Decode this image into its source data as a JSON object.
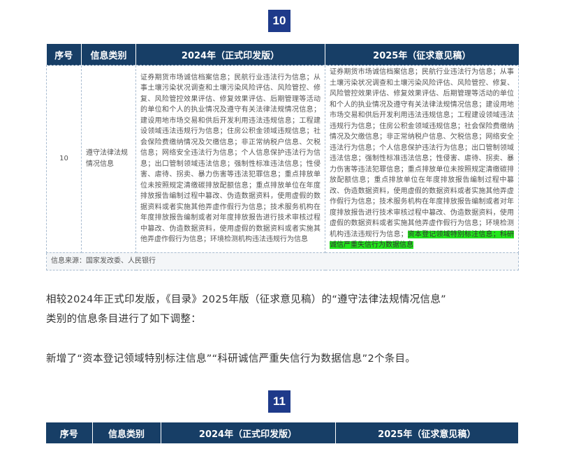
{
  "section1": {
    "badge": "10",
    "headers": [
      "序号",
      "信息类别",
      "2024年（正式印发版）",
      "2025年（征求意见稿）"
    ],
    "row": {
      "num": "10",
      "category": "遵守法律法规情况信息",
      "col2024": "证券期货市场诚信档案信息；民航行业违法行为信息；从事土壤污染状况调查和土壤污染风险评估、风险管控、修复、风险管控效果评估、修复效果评估、后期管理等活动的单位和个人的执业情况及遵守有关法律法规情况信息；建设用地市场交易和供后开发利用违法违规信息；工程建设领域违法违规行为信息；住房公积金领域违规信息；社会保险费缴纳情况及欠缴信息；非正常纳税户信息、欠税信息；网络安全违法行为信息；个人信息保护违法行为信息；出口管制领域违法信息；强制性标准违法信息；性侵害、虐待、拐卖、暴力伤害等违法犯罪信息；重点排放单位未按照规定清缴碳排放配额信息；重点排放单位在年度排放报告编制过程中篡改、伪造数据资料，使用虚假的数据资料或者实施其他弄虚作假行为信息；技术服务机构在年度排放报告编制或者对年度排放报告进行技术审核过程中篡改、伪造数据资料，使用虚假的数据资料或者实施其他弄虚作假行为信息；环境检测机构违法违规行为信息",
      "col2025_main": "证券期货市场诚信档案信息；民航行业违法行为信息；从事土壤污染状况调查和土壤污染风险评估、风险管控、修复、风险管控效果评估、修复效果评估、后期管理等活动的单位和个人的执业情况及遵守有关法律法规情况信息；建设用地市场交易和供后开发利用违法违规信息；工程建设领域违法违规行为信息；住房公积金领域违规信息；社会保险费缴纳情况及欠缴信息；非正常纳税户信息、欠税信息；网络安全违法行为信息；个人信息保护违法行为信息；出口管制领域违法信息；强制性标准违法信息；性侵害、虐待、拐卖、暴力伤害等违法犯罪信息；重点排放单位未按照规定清缴碳排放配额信息；重点排放单位在年度排放报告编制过程中篡改、伪造数据资料，使用虚假的数据资料或者实施其他弄虚作假行为信息；技术服务机构在年度排放报告编制或者对年度排放报告进行技术审核过程中篡改、伪造数据资料，使用虚假的数据资料或者实施其他弄虚作假行为信息；环境检测机构违法违规行为信息；",
      "col2025_highlight": "资本登记领域特别标注信息；科研诚信严重失信行为数据信息"
    },
    "source": "信息来源：国家发改委、人民银行"
  },
  "paragraphs": {
    "p1": "相较2024年正式印发版，《目录》2025年版（征求意见稿）的“遵守法律法规情况信息”",
    "p2": "类别的信息条目进行了如下调整：",
    "p3": "新增了“资本登记领域特别标注信息”“科研诚信严重失信行为数据信息”2个条目。"
  },
  "section2": {
    "badge": "11",
    "headers": [
      "序号",
      "信息类别",
      "2024年（正式印发版）",
      "2025年（征求意见稿）"
    ]
  },
  "colors": {
    "header_bg": "#173e66",
    "badge_bg": "#1e3a8a",
    "highlight": "#22e61c"
  }
}
